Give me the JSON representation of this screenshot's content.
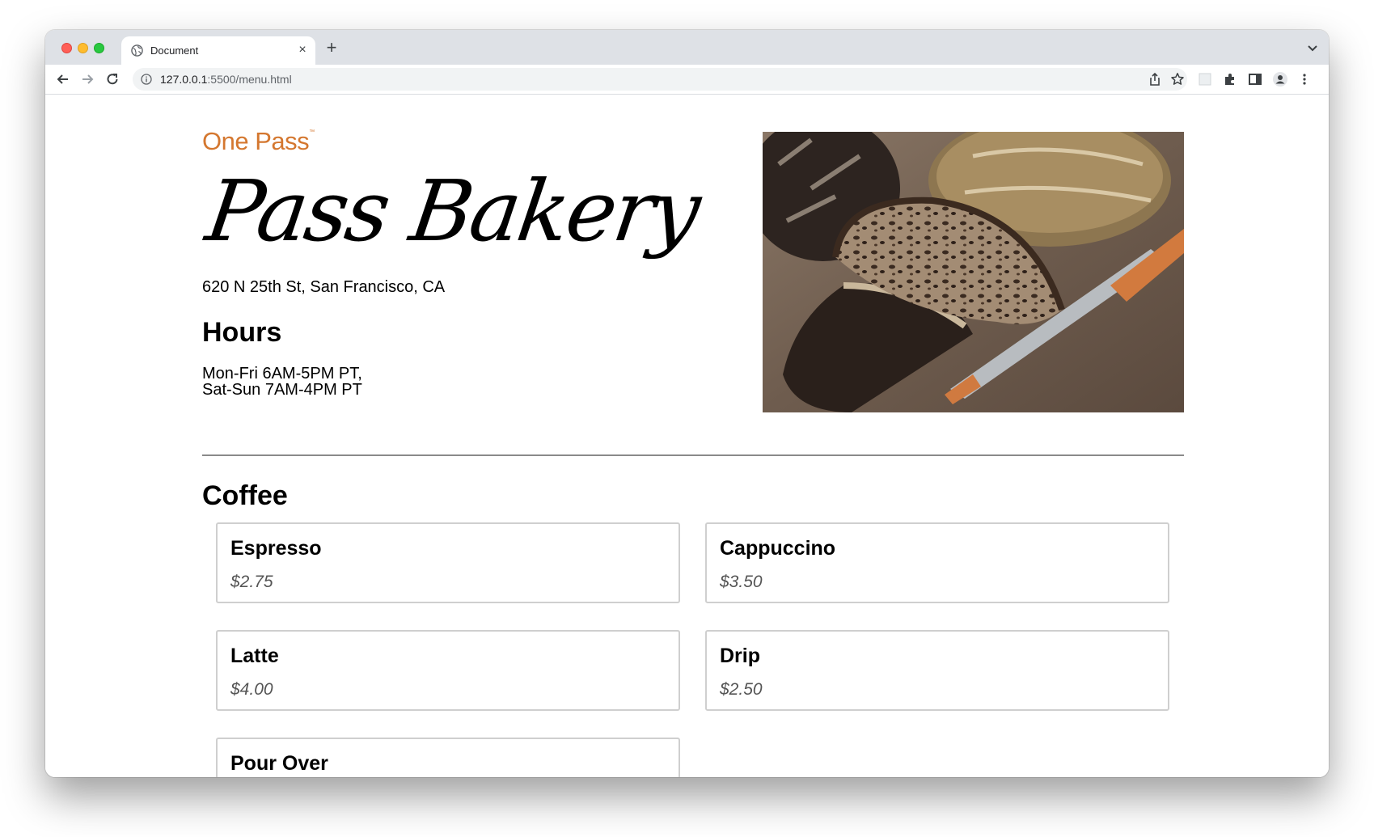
{
  "browser": {
    "tab_title": "Document",
    "url_host": "127.0.0.1",
    "url_rest": ":5500/menu.html"
  },
  "page": {
    "brand": "One Pass",
    "brand_mark": "™",
    "title": "Pass Bakery",
    "address": "620 N 25th St, San Francisco, CA",
    "hours_heading": "Hours",
    "hours": [
      "Mon-Fri 6AM-5PM PT,",
      "Sat-Sun 7AM-4PM PT"
    ],
    "section_heading": "Coffee",
    "menu_items": [
      {
        "name": "Espresso",
        "price": "$2.75"
      },
      {
        "name": "Cappuccino",
        "price": "$3.50"
      },
      {
        "name": "Latte",
        "price": "$4.00"
      },
      {
        "name": "Drip",
        "price": "$2.50"
      },
      {
        "name": "Pour Over",
        "price": ""
      }
    ]
  },
  "colors": {
    "brand_orange": "#d4772f",
    "tabbar": "#dee1e6",
    "card_border": "#cfcfcf",
    "price_gray": "#555555"
  },
  "icons": [
    "globe-icon",
    "close-icon",
    "plus-icon",
    "chevron-down-icon",
    "back-arrow-icon",
    "forward-arrow-icon",
    "reload-icon",
    "info-icon",
    "share-icon",
    "star-icon",
    "extension-puzzle-icon",
    "side-panel-icon",
    "profile-icon",
    "more-vert-icon"
  ]
}
